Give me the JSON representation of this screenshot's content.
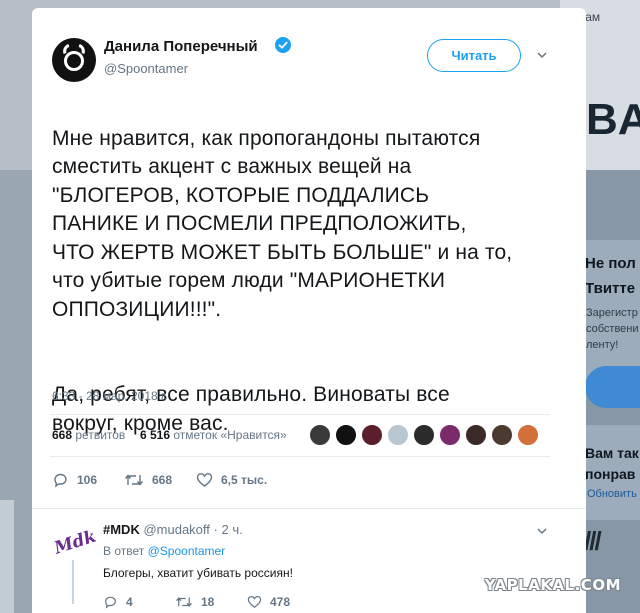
{
  "background": {
    "top_word": "Зам",
    "big_word": "BA",
    "right_heading_1": "Не пол",
    "right_heading_2": "Твитте",
    "right_sub": [
      "Зарегистр",
      "собствени",
      "ленту!"
    ],
    "right_heading_3": "Вам так",
    "right_heading_4": "понрав",
    "right_link": "Обновить"
  },
  "tweet": {
    "author_name": "Данила Поперечный",
    "author_handle": "@Spoontamer",
    "follow_label": "Читать",
    "text_paragraph_1": "Мне нравится, как пропогандоны пытаются\nсместить акцент с важных вещей на\n\"БЛОГЕРОВ, КОТОРЫЕ ПОДДАЛИСЬ\nПАНИКЕ И ПОСМЕЛИ ПРЕДПОЛОЖИТЬ,\nЧТО ЖЕРТВ МОЖЕТ БЫТЬ БОЛЬШЕ\" и на то,\nчто убитые горем люди \"МАРИОНЕТКИ\nОППОЗИЦИИ!!!\".",
    "text_paragraph_2": "Да, ребят, все правильно. Виноваты все\nвокруг, кроме вас.",
    "timestamp": "6:33 - 28 мар. 2018 г.",
    "retweets_count": "668",
    "retweets_label": "ретвитов",
    "likes_count": "6 516",
    "likes_label": "отметок «Нравится»",
    "reply_count": "106",
    "retweet_action_count": "668",
    "like_action_count": "6,5 тыс.",
    "liker_colors": [
      "#3a3a3a",
      "#111111",
      "#5a1f2a",
      "#b9c7d3",
      "#2b2b2b",
      "#7b2a6a",
      "#3b2a28",
      "#4a3a30",
      "#d2703a"
    ]
  },
  "reply": {
    "logo_text": "Mdk",
    "author_name": "#MDK",
    "author_handle": "@mudakoff",
    "time_ago": "· 2 ч.",
    "in_reply_to_label": "В ответ",
    "in_reply_to_handle": "@Spoontamer",
    "text": "Блогеры, хватит убивать россиян!",
    "reply_count": "4",
    "retweet_count": "18",
    "like_count": "478"
  },
  "watermark": "YAPLAKAL.COM"
}
